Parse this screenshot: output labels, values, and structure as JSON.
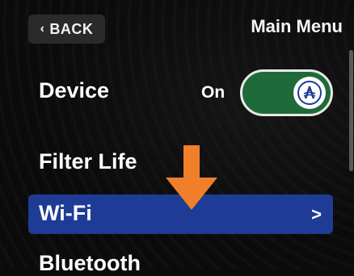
{
  "header": {
    "back_label": "BACK",
    "title": "Main Menu"
  },
  "menu": {
    "device": {
      "label": "Device",
      "toggle_state": "On",
      "toggle_on": true
    },
    "filter_life": {
      "label": "Filter Life"
    },
    "wifi": {
      "label": "Wi-Fi",
      "selected": true
    },
    "bluetooth": {
      "label": "Bluetooth"
    }
  },
  "icons": {
    "back": "chevron-left-icon",
    "toggle_knob": "brand-logo-icon",
    "row_next": "chevron-right-icon",
    "pointer": "down-arrow-icon"
  },
  "colors": {
    "background": "#0b0b0b",
    "selected_row": "#1e3c96",
    "toggle_on": "#1f6a39",
    "arrow": "#f07f2a",
    "back_button": "#2a2a2a"
  }
}
